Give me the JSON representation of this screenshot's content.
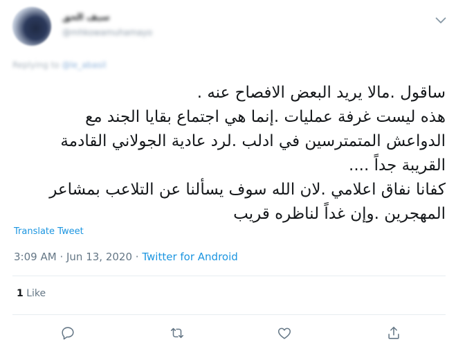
{
  "author": {
    "display_name": "سيف الحق",
    "handle": "@mhkowamuhamayo"
  },
  "reply_context": {
    "prefix": "Replying to",
    "mention": "@le_abasil"
  },
  "tweet": {
    "lines": [
      "ساقول .مالا يريد البعض الافصاح عنه .",
      "هذه ليست غرفة عمليات .إنما هي اجتماع بقايا الجند مع",
      "الدواعش المتمترسين في ادلب .لرد عادية الجولاني القادمة",
      "القريبة جداً ....",
      "كفانا نفاق اعلامي .لان الله سوف يسألنا عن التلاعب بمشاعر",
      "المهجرين .وإن غداً لناظره قريب"
    ],
    "translate_label": "Translate Tweet",
    "time": "3:09 AM",
    "separator": "·",
    "date": "Jun 13, 2020",
    "source": "Twitter for Android"
  },
  "stats": {
    "like_count": "1",
    "like_label": "Like"
  },
  "icons": {
    "menu": "chevron-down-icon",
    "reply": "reply-icon",
    "retweet": "retweet-icon",
    "like": "heart-icon",
    "share": "share-icon"
  },
  "colors": {
    "link": "#1b95e0",
    "muted": "#657786",
    "text": "#14171a",
    "divider": "#e6ecf0"
  }
}
